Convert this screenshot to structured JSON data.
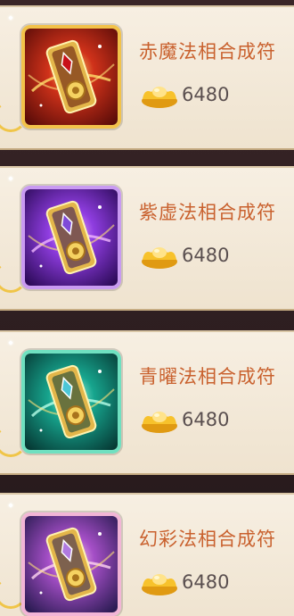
{
  "items": [
    {
      "name": "赤魔法相合成符",
      "price": "6480",
      "theme": {
        "bg1": "#d0321a",
        "bg2": "#5a0c08",
        "frame": "#f2c24a",
        "glow": "#ffdf6b",
        "gem": "#c8101a"
      }
    },
    {
      "name": "紫虚法相合成符",
      "price": "6480",
      "theme": {
        "bg1": "#8f3de0",
        "bg2": "#2d0b5a",
        "frame": "#c99af2",
        "glow": "#f0b6ff",
        "gem": "#7f4ad8"
      }
    },
    {
      "name": "青曜法相合成符",
      "price": "6480",
      "theme": {
        "bg1": "#17a58e",
        "bg2": "#063a35",
        "frame": "#6fe0c0",
        "glow": "#b6ffe9",
        "gem": "#4bc6d6"
      }
    },
    {
      "name": "幻彩法相合成符",
      "price": "6480",
      "theme": {
        "bg1": "#a54fc7",
        "bg2": "#2a1b52",
        "frame": "#f2b5d6",
        "glow": "#ffd6f0",
        "gem": "#b07ae0"
      }
    }
  ],
  "icons": {
    "item": "talisman-icon",
    "currency": "gold-ingot-icon"
  }
}
